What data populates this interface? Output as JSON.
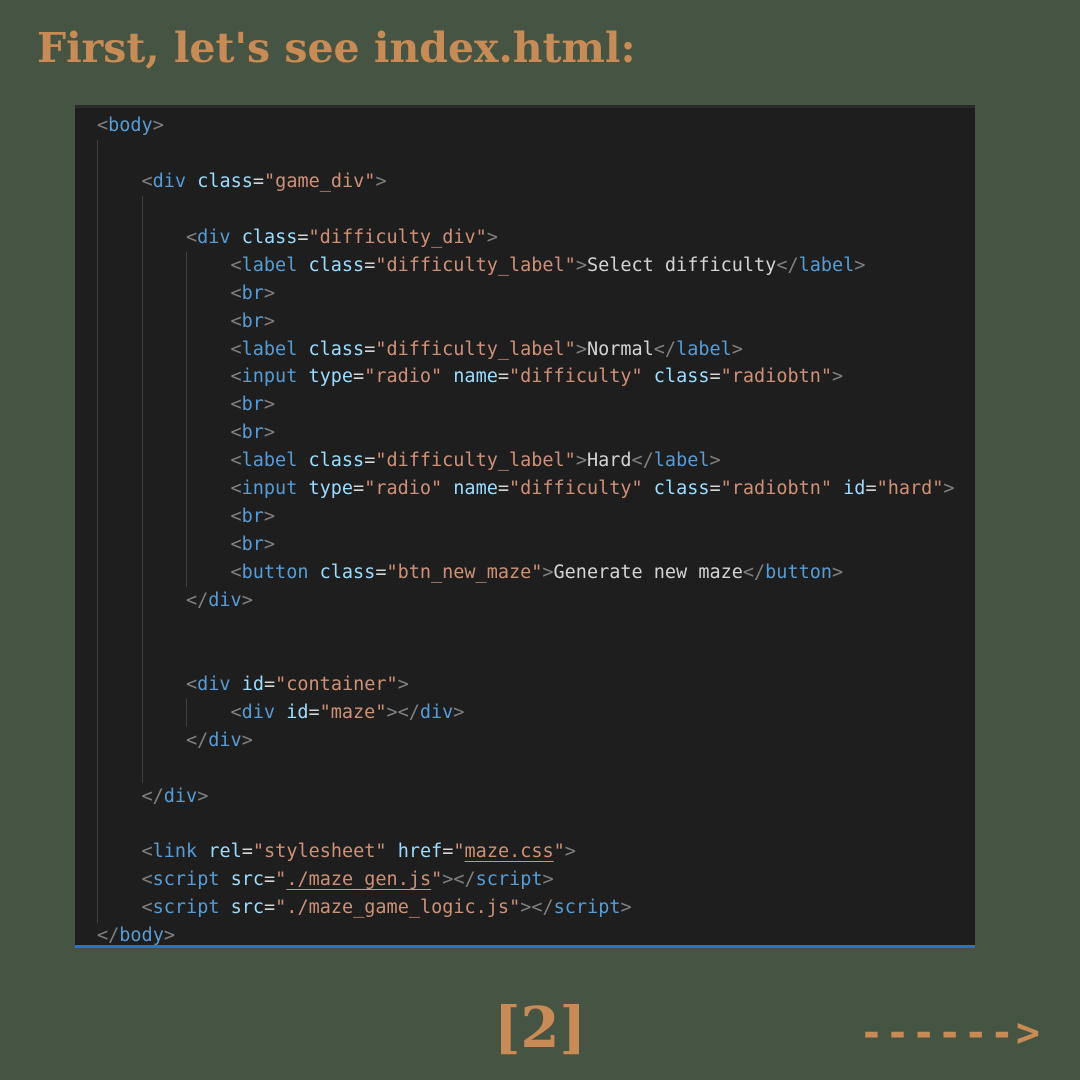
{
  "header": {
    "title": "First, let's see index.html:"
  },
  "code_lines": [
    {
      "indent": 0,
      "tokens": [
        [
          "punct",
          "<"
        ],
        [
          "tag",
          "body"
        ],
        [
          "punct",
          ">"
        ]
      ]
    },
    {
      "indent": 0,
      "tokens": []
    },
    {
      "indent": 1,
      "tokens": [
        [
          "punct",
          "<"
        ],
        [
          "tag",
          "div"
        ],
        [
          "text",
          " "
        ],
        [
          "attr",
          "class"
        ],
        [
          "text",
          "="
        ],
        [
          "str",
          "\"game_div\""
        ],
        [
          "punct",
          ">"
        ]
      ]
    },
    {
      "indent": 0,
      "tokens": []
    },
    {
      "indent": 2,
      "tokens": [
        [
          "punct",
          "<"
        ],
        [
          "tag",
          "div"
        ],
        [
          "text",
          " "
        ],
        [
          "attr",
          "class"
        ],
        [
          "text",
          "="
        ],
        [
          "str",
          "\"difficulty_div\""
        ],
        [
          "punct",
          ">"
        ]
      ]
    },
    {
      "indent": 3,
      "tokens": [
        [
          "punct",
          "<"
        ],
        [
          "tag",
          "label"
        ],
        [
          "text",
          " "
        ],
        [
          "attr",
          "class"
        ],
        [
          "text",
          "="
        ],
        [
          "str",
          "\"difficulty_label\""
        ],
        [
          "punct",
          ">"
        ],
        [
          "text",
          "Select difficulty"
        ],
        [
          "punct",
          "</"
        ],
        [
          "tag",
          "label"
        ],
        [
          "punct",
          ">"
        ]
      ]
    },
    {
      "indent": 3,
      "tokens": [
        [
          "punct",
          "<"
        ],
        [
          "tag",
          "br"
        ],
        [
          "punct",
          ">"
        ]
      ]
    },
    {
      "indent": 3,
      "tokens": [
        [
          "punct",
          "<"
        ],
        [
          "tag",
          "br"
        ],
        [
          "punct",
          ">"
        ]
      ]
    },
    {
      "indent": 3,
      "tokens": [
        [
          "punct",
          "<"
        ],
        [
          "tag",
          "label"
        ],
        [
          "text",
          " "
        ],
        [
          "attr",
          "class"
        ],
        [
          "text",
          "="
        ],
        [
          "str",
          "\"difficulty_label\""
        ],
        [
          "punct",
          ">"
        ],
        [
          "text",
          "Normal"
        ],
        [
          "punct",
          "</"
        ],
        [
          "tag",
          "label"
        ],
        [
          "punct",
          ">"
        ]
      ]
    },
    {
      "indent": 3,
      "tokens": [
        [
          "punct",
          "<"
        ],
        [
          "tag",
          "input"
        ],
        [
          "text",
          " "
        ],
        [
          "attr",
          "type"
        ],
        [
          "text",
          "="
        ],
        [
          "str",
          "\"radio\""
        ],
        [
          "text",
          " "
        ],
        [
          "attr",
          "name"
        ],
        [
          "text",
          "="
        ],
        [
          "str",
          "\"difficulty\""
        ],
        [
          "text",
          " "
        ],
        [
          "attr",
          "class"
        ],
        [
          "text",
          "="
        ],
        [
          "str",
          "\"radiobtn\""
        ],
        [
          "punct",
          ">"
        ]
      ]
    },
    {
      "indent": 3,
      "tokens": [
        [
          "punct",
          "<"
        ],
        [
          "tag",
          "br"
        ],
        [
          "punct",
          ">"
        ]
      ]
    },
    {
      "indent": 3,
      "tokens": [
        [
          "punct",
          "<"
        ],
        [
          "tag",
          "br"
        ],
        [
          "punct",
          ">"
        ]
      ]
    },
    {
      "indent": 3,
      "tokens": [
        [
          "punct",
          "<"
        ],
        [
          "tag",
          "label"
        ],
        [
          "text",
          " "
        ],
        [
          "attr",
          "class"
        ],
        [
          "text",
          "="
        ],
        [
          "str",
          "\"difficulty_label\""
        ],
        [
          "punct",
          ">"
        ],
        [
          "text",
          "Hard"
        ],
        [
          "punct",
          "</"
        ],
        [
          "tag",
          "label"
        ],
        [
          "punct",
          ">"
        ]
      ]
    },
    {
      "indent": 3,
      "tokens": [
        [
          "punct",
          "<"
        ],
        [
          "tag",
          "input"
        ],
        [
          "text",
          " "
        ],
        [
          "attr",
          "type"
        ],
        [
          "text",
          "="
        ],
        [
          "str",
          "\"radio\""
        ],
        [
          "text",
          " "
        ],
        [
          "attr",
          "name"
        ],
        [
          "text",
          "="
        ],
        [
          "str",
          "\"difficulty\""
        ],
        [
          "text",
          " "
        ],
        [
          "attr",
          "class"
        ],
        [
          "text",
          "="
        ],
        [
          "str",
          "\"radiobtn\""
        ],
        [
          "text",
          " "
        ],
        [
          "attr",
          "id"
        ],
        [
          "text",
          "="
        ],
        [
          "str",
          "\"hard\""
        ],
        [
          "punct",
          ">"
        ]
      ]
    },
    {
      "indent": 3,
      "tokens": [
        [
          "punct",
          "<"
        ],
        [
          "tag",
          "br"
        ],
        [
          "punct",
          ">"
        ]
      ]
    },
    {
      "indent": 3,
      "tokens": [
        [
          "punct",
          "<"
        ],
        [
          "tag",
          "br"
        ],
        [
          "punct",
          ">"
        ]
      ]
    },
    {
      "indent": 3,
      "tokens": [
        [
          "punct",
          "<"
        ],
        [
          "tag",
          "button"
        ],
        [
          "text",
          " "
        ],
        [
          "attr",
          "class"
        ],
        [
          "text",
          "="
        ],
        [
          "str",
          "\"btn_new_maze\""
        ],
        [
          "punct",
          ">"
        ],
        [
          "text",
          "Generate new maze"
        ],
        [
          "punct",
          "</"
        ],
        [
          "tag",
          "button"
        ],
        [
          "punct",
          ">"
        ]
      ]
    },
    {
      "indent": 2,
      "tokens": [
        [
          "punct",
          "</"
        ],
        [
          "tag",
          "div"
        ],
        [
          "punct",
          ">"
        ]
      ]
    },
    {
      "indent": 0,
      "tokens": []
    },
    {
      "indent": 0,
      "tokens": []
    },
    {
      "indent": 2,
      "tokens": [
        [
          "punct",
          "<"
        ],
        [
          "tag",
          "div"
        ],
        [
          "text",
          " "
        ],
        [
          "attr",
          "id"
        ],
        [
          "text",
          "="
        ],
        [
          "str",
          "\"container\""
        ],
        [
          "punct",
          ">"
        ]
      ]
    },
    {
      "indent": 3,
      "tokens": [
        [
          "punct",
          "<"
        ],
        [
          "tag",
          "div"
        ],
        [
          "text",
          " "
        ],
        [
          "attr",
          "id"
        ],
        [
          "text",
          "="
        ],
        [
          "str",
          "\"maze\""
        ],
        [
          "punct",
          "></"
        ],
        [
          "tag",
          "div"
        ],
        [
          "punct",
          ">"
        ]
      ]
    },
    {
      "indent": 2,
      "tokens": [
        [
          "punct",
          "</"
        ],
        [
          "tag",
          "div"
        ],
        [
          "punct",
          ">"
        ]
      ]
    },
    {
      "indent": 0,
      "tokens": []
    },
    {
      "indent": 1,
      "tokens": [
        [
          "punct",
          "</"
        ],
        [
          "tag",
          "div"
        ],
        [
          "punct",
          ">"
        ]
      ]
    },
    {
      "indent": 0,
      "tokens": []
    },
    {
      "indent": 1,
      "tokens": [
        [
          "punct",
          "<"
        ],
        [
          "tag",
          "link"
        ],
        [
          "text",
          " "
        ],
        [
          "attr",
          "rel"
        ],
        [
          "text",
          "="
        ],
        [
          "str",
          "\"stylesheet\""
        ],
        [
          "text",
          " "
        ],
        [
          "attr",
          "href"
        ],
        [
          "text",
          "="
        ],
        [
          "str",
          "\""
        ],
        [
          "strlink",
          "maze.css"
        ],
        [
          "str",
          "\""
        ],
        [
          "punct",
          ">"
        ]
      ]
    },
    {
      "indent": 1,
      "tokens": [
        [
          "punct",
          "<"
        ],
        [
          "tag",
          "script"
        ],
        [
          "text",
          " "
        ],
        [
          "attr",
          "src"
        ],
        [
          "text",
          "="
        ],
        [
          "str",
          "\""
        ],
        [
          "strlink",
          "./maze_gen.js"
        ],
        [
          "str",
          "\""
        ],
        [
          "punct",
          "></"
        ],
        [
          "tag",
          "script"
        ],
        [
          "punct",
          ">"
        ]
      ]
    },
    {
      "indent": 1,
      "tokens": [
        [
          "punct",
          "<"
        ],
        [
          "tag",
          "script"
        ],
        [
          "text",
          " "
        ],
        [
          "attr",
          "src"
        ],
        [
          "text",
          "="
        ],
        [
          "str",
          "\"./maze_game_logic.js\""
        ],
        [
          "punct",
          "></"
        ],
        [
          "tag",
          "script"
        ],
        [
          "punct",
          ">"
        ]
      ]
    },
    {
      "indent": 0,
      "tokens": [
        [
          "punct",
          "</"
        ],
        [
          "tag",
          "body"
        ],
        [
          "punct",
          ">"
        ]
      ]
    }
  ],
  "footer": {
    "page_number": "[2]",
    "next_arrow": "------>"
  },
  "colors": {
    "background": "#465543",
    "accent": "#c98b55",
    "editor_bg": "#1e1e1e",
    "tag": "#569cd6",
    "attribute": "#9cdcfe",
    "string": "#ce9178",
    "text": "#d4d4d4",
    "bracket": "#808080",
    "status_bar": "#2b73c9"
  }
}
